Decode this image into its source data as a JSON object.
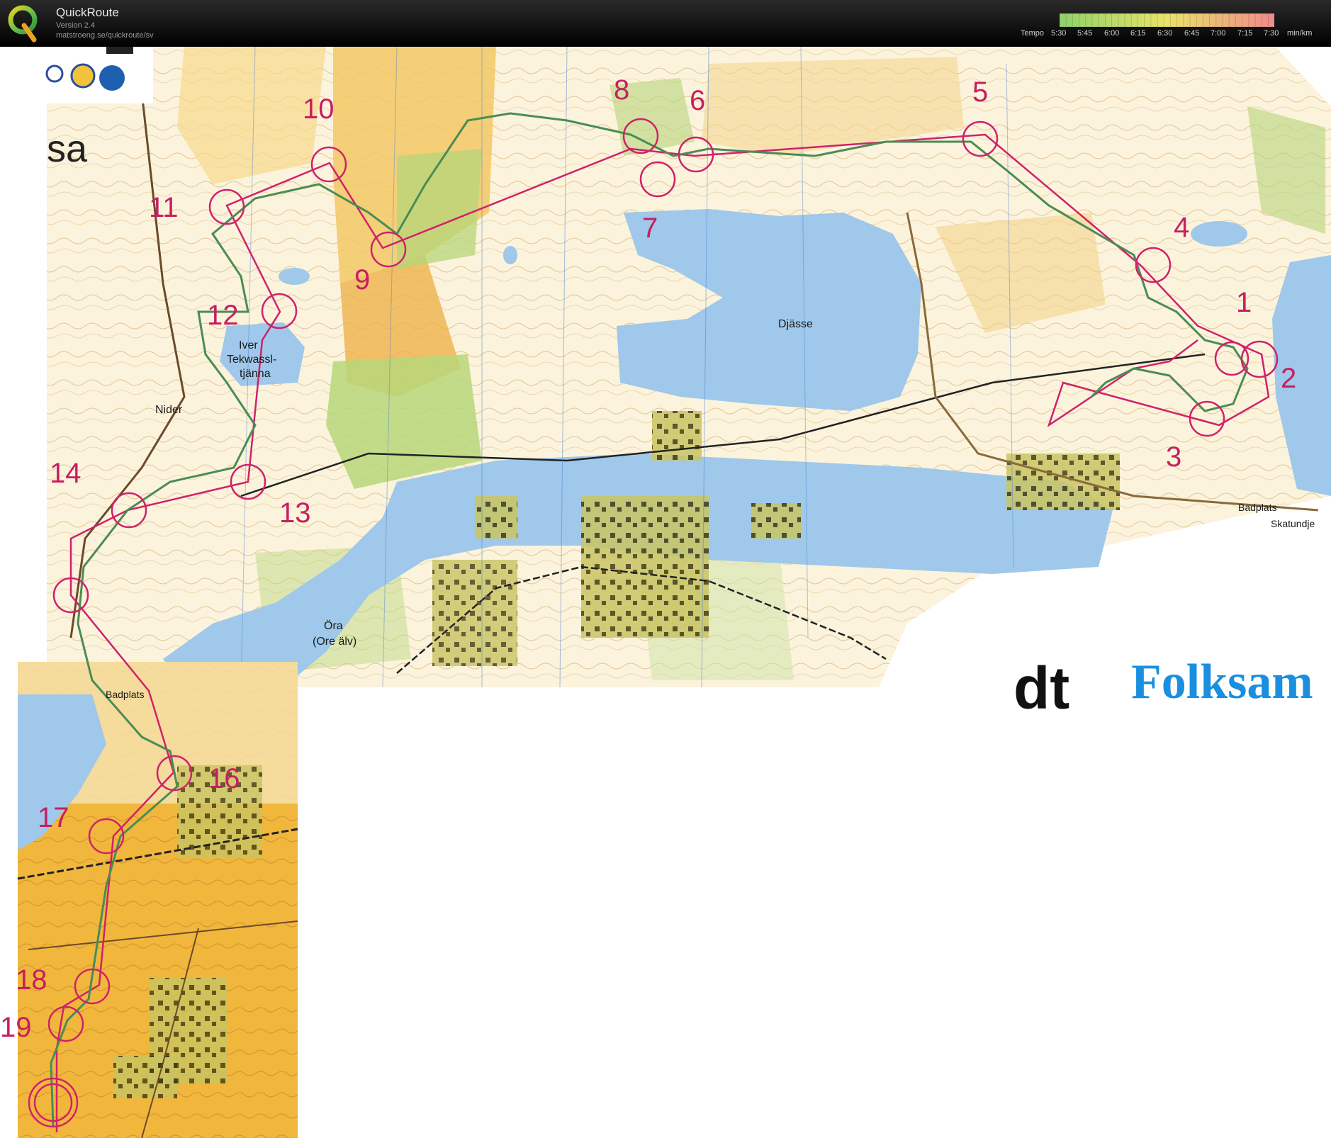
{
  "app": {
    "title": "QuickRoute",
    "version": "Version 2.4",
    "url": "matstroeng.se/quickroute/sv",
    "logo_letter": "Q"
  },
  "pace_scale": {
    "label": "Tempo",
    "values": [
      "5:30",
      "5:45",
      "6:00",
      "6:15",
      "6:30",
      "6:45",
      "7:00",
      "7:15",
      "7:30"
    ],
    "unit": "min/km",
    "color_from": "#8fd16a",
    "color_mid": "#e9e36a",
    "color_to": "#f08a8a"
  },
  "map": {
    "colors": {
      "water": "#9fc8ea",
      "forest_open": "#f7e7b5",
      "field": "#f1b73c",
      "green": "#b7d67a",
      "building": "#76711d",
      "course": "#d0216b",
      "route": "#4a8c55"
    },
    "controls": [
      "1",
      "2",
      "3",
      "4",
      "5",
      "6",
      "7",
      "8",
      "9",
      "10",
      "11",
      "12",
      "13",
      "14",
      "16",
      "17",
      "18",
      "19"
    ],
    "place_names": {
      "djasse": "Djässe",
      "iver": "Iver",
      "tekwassl": "Tekwassl-",
      "tjanna": "tjänna",
      "nider": "Nider",
      "ora": "Öra",
      "ore_alv": "(Ore älv)",
      "badplats_1": "Badplats",
      "badplats_2": "Badplats",
      "skatundje": "Skatundje",
      "sa": "sa",
      "dt": "dt",
      "folksam": "Folksam"
    }
  }
}
